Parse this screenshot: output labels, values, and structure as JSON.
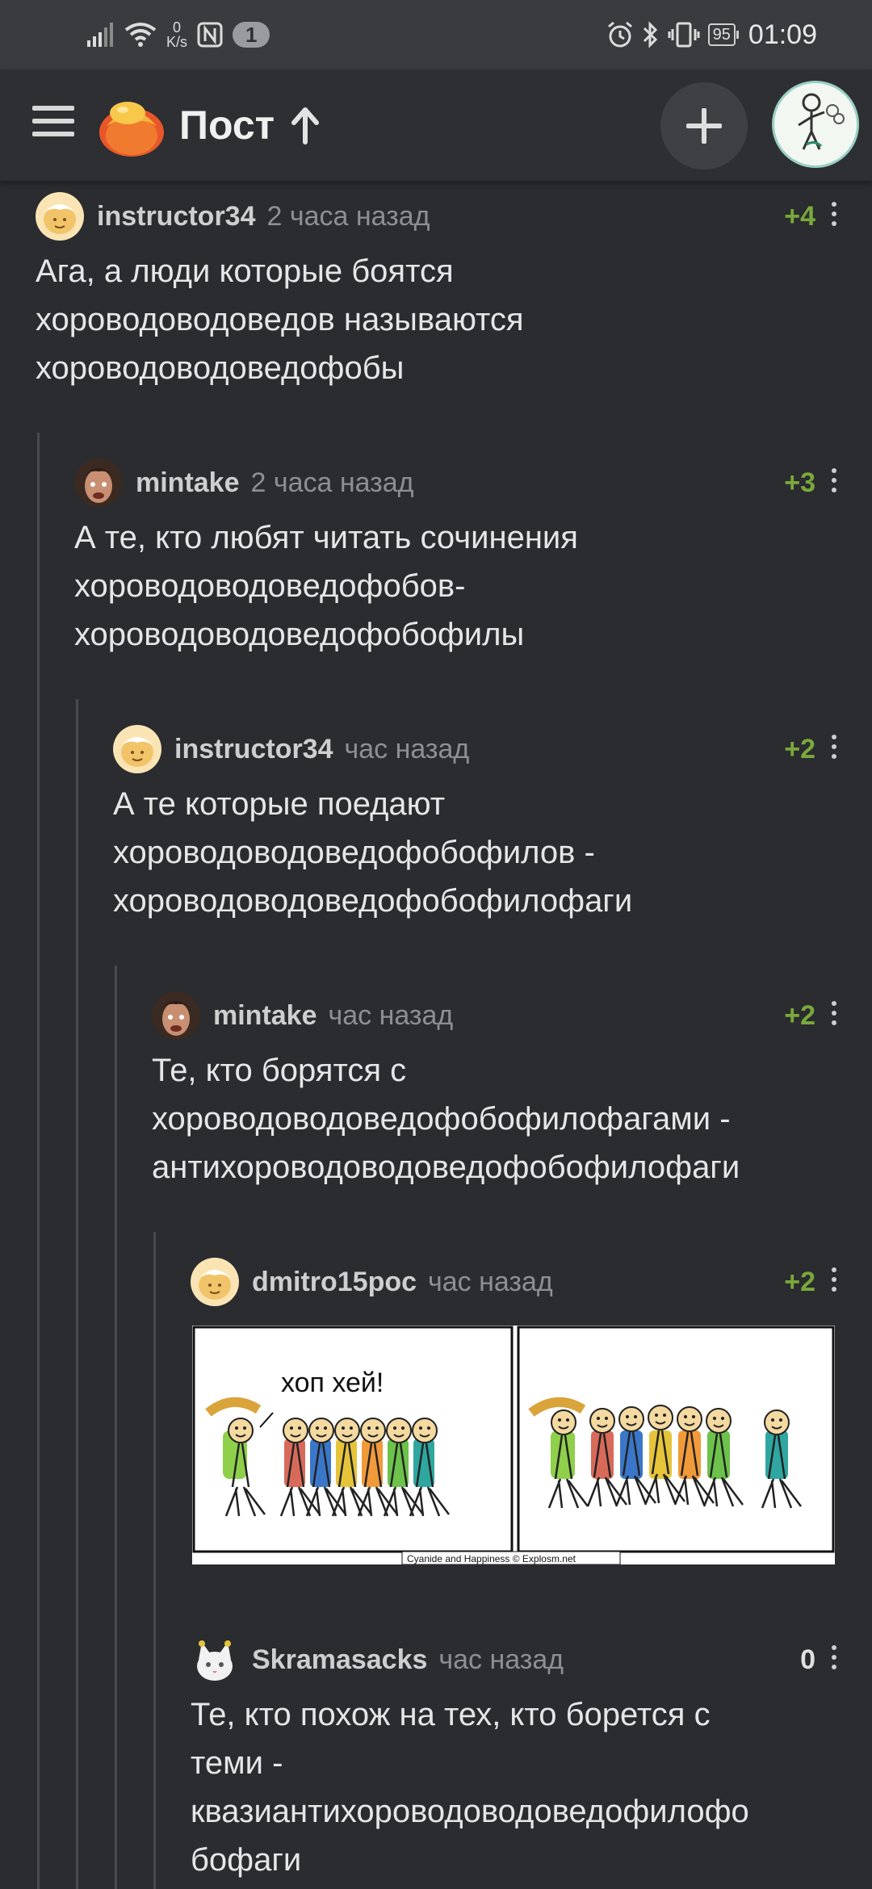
{
  "status_bar": {
    "net_speed_value": "0",
    "net_speed_unit": "K/s",
    "notification_count": "1",
    "battery": "95",
    "time": "01:09"
  },
  "app_bar": {
    "title": "Пост"
  },
  "comments": [
    {
      "author": "instructor34",
      "time": "2 часа назад",
      "rating": "+4",
      "text": "Ага, а люди которые боятся\nхороводоводоведов называются\nхороводоводоведофобы"
    },
    {
      "author": "mintake",
      "time": "2 часа назад",
      "rating": "+3",
      "text": "А те, кто любят читать сочинения\nхороводоводоведофобов-\nхороводоводоведофобофилы"
    },
    {
      "author": "instructor34",
      "time": "час назад",
      "rating": "+2",
      "text": "А те которые поедают\nхороводоводоведофобофилов -\nхороводоводоведофобофилофаги"
    },
    {
      "author": "mintake",
      "time": "час назад",
      "rating": "+2",
      "text": "Те, кто борятся с\nхороводоводоведофобофилофагами -\nантихороводоводоведофобофилофаги"
    },
    {
      "author": "dmitro15poc",
      "time": "час назад",
      "rating": "+2",
      "comic": {
        "speech": "хоп хей!",
        "credit": "Cyanide and Happiness © Explosm.net"
      }
    },
    {
      "author": "Skramasacks",
      "time": "час назад",
      "rating": "0",
      "text": "Те, кто похож на тех, кто борется с\nтеми -\nквазиантихороводоводоведофилофо\nбофаги"
    }
  ],
  "colors": {
    "background": "#2a2c30",
    "rating_positive": "#7aa83a",
    "text": "#e6e6e6",
    "muted": "#8d8f93"
  }
}
